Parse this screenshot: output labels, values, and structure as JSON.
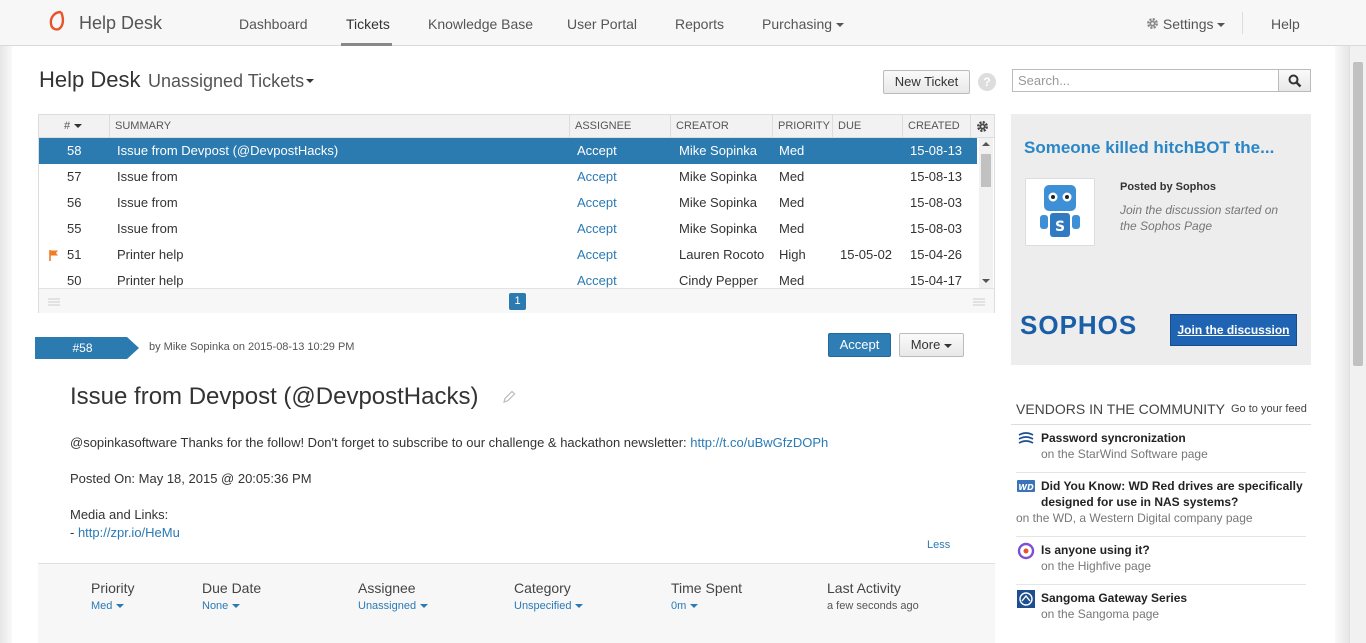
{
  "nav": {
    "brand": "Help Desk",
    "items": [
      "Dashboard",
      "Tickets",
      "Knowledge Base",
      "User Portal",
      "Reports",
      "Purchasing"
    ],
    "settings": "Settings",
    "help": "Help",
    "active_index": 1
  },
  "header": {
    "title": "Help Desk",
    "subtitle": "Unassigned Tickets",
    "new_ticket": "New Ticket",
    "help_glyph": "?",
    "search_placeholder": "Search..."
  },
  "table": {
    "columns": [
      "#",
      "SUMMARY",
      "ASSIGNEE",
      "CREATOR",
      "PRIORITY",
      "DUE",
      "CREATED"
    ],
    "rows": [
      {
        "id": "58",
        "summary": "Issue from Devpost (@DevpostHacks)",
        "assignee": "Accept",
        "creator": "Mike Sopinka",
        "priority": "Med",
        "due": "",
        "created": "15-08-13",
        "flag": false,
        "selected": true
      },
      {
        "id": "57",
        "summary": "Issue from",
        "assignee": "Accept",
        "creator": "Mike Sopinka",
        "priority": "Med",
        "due": "",
        "created": "15-08-13",
        "flag": false,
        "selected": false
      },
      {
        "id": "56",
        "summary": "Issue from",
        "assignee": "Accept",
        "creator": "Mike Sopinka",
        "priority": "Med",
        "due": "",
        "created": "15-08-03",
        "flag": false,
        "selected": false
      },
      {
        "id": "55",
        "summary": "Issue from",
        "assignee": "Accept",
        "creator": "Mike Sopinka",
        "priority": "Med",
        "due": "",
        "created": "15-08-03",
        "flag": false,
        "selected": false
      },
      {
        "id": "51",
        "summary": "Printer help",
        "assignee": "Accept",
        "creator": "Lauren Rocoto",
        "priority": "High",
        "due": "15-05-02",
        "created": "15-04-26",
        "flag": true,
        "selected": false
      },
      {
        "id": "50",
        "summary": "Printer help",
        "assignee": "Accept",
        "creator": "Cindy Pepper",
        "priority": "Med",
        "due": "",
        "created": "15-04-17",
        "flag": false,
        "selected": false
      }
    ],
    "page": "1"
  },
  "ticket": {
    "number": "#58",
    "byline": "by Mike Sopinka on 2015-08-13 10:29 PM",
    "accept": "Accept",
    "more": "More",
    "title": "Issue from Devpost (@DevpostHacks)",
    "body_prefix": "@sopinkasoftware Thanks for the follow! Don't forget to subscribe to our challenge & hackathon newsletter: ",
    "body_link": "http://t.co/uBwGfzDOPh",
    "posted_on": "Posted On: May 18, 2015 @ 20:05:36 PM",
    "media_label": "Media and Links:",
    "media_prefix": "- ",
    "media_link": "http://zpr.io/HeMu",
    "less": "Less"
  },
  "fields": [
    {
      "label": "Priority",
      "value": "Med",
      "dropdown": true
    },
    {
      "label": "Due Date",
      "value": "None",
      "dropdown": true
    },
    {
      "label": "Assignee",
      "value": "Unassigned",
      "dropdown": true
    },
    {
      "label": "Category",
      "value": "Unspecified",
      "dropdown": true
    },
    {
      "label": "Time Spent",
      "value": "0m",
      "dropdown": true
    },
    {
      "label": "Last Activity",
      "value": "a few seconds ago",
      "dropdown": false
    }
  ],
  "ad": {
    "headline": "Someone killed hitchBOT the...",
    "posted_by": "Posted by Sophos",
    "description": "Join the discussion started on the Sophos Page",
    "logo": "SOPHOS",
    "button": "Join the discussion"
  },
  "vendors": {
    "title": "VENDORS IN THE COMMUNITY",
    "feed_link": "Go to your feed",
    "items": [
      {
        "title": "Password syncronization",
        "sub": "on the StarWind Software page",
        "icon": "starwind-icon"
      },
      {
        "title": "Did You Know: WD Red drives are specifically designed for use in NAS systems?",
        "sub": "on the WD, a Western Digital company page",
        "icon": "wd-icon"
      },
      {
        "title": "Is anyone using it?",
        "sub": "on the Highfive page",
        "icon": "highfive-icon"
      },
      {
        "title": "Sangoma Gateway Series",
        "sub": "on the Sangoma page",
        "icon": "sangoma-icon"
      }
    ]
  },
  "colors": {
    "accent": "#2b7ab0",
    "link": "#2a7ab5",
    "flag": "#f07c24",
    "sophos": "#1b5ea8"
  }
}
